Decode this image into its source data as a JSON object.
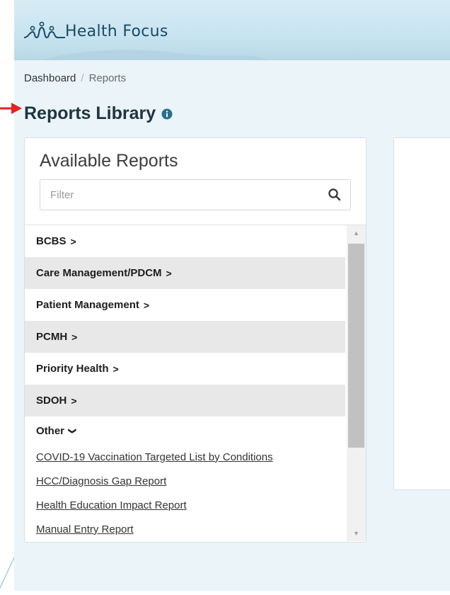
{
  "brand": {
    "name": "Health Focus"
  },
  "breadcrumb": {
    "items": [
      "Dashboard",
      "Reports"
    ],
    "separator": "/"
  },
  "page": {
    "title": "Reports Library"
  },
  "panel": {
    "title": "Available Reports",
    "filter": {
      "placeholder": "Filter",
      "value": ""
    },
    "categories": [
      {
        "label": "BCBS",
        "chevron": ">"
      },
      {
        "label": "Care Management/PDCM",
        "chevron": ">"
      },
      {
        "label": "Patient Management",
        "chevron": ">"
      },
      {
        "label": "PCMH",
        "chevron": ">"
      },
      {
        "label": "Priority Health",
        "chevron": ">"
      },
      {
        "label": "SDOH",
        "chevron": ">"
      },
      {
        "label": "Other",
        "chevron": "❯"
      }
    ],
    "other_reports": [
      "COVID-19 Vaccination Targeted List by Conditions",
      "HCC/Diagnosis Gap Report",
      "Health Education Impact Report",
      "Manual Entry Report"
    ]
  },
  "colors": {
    "accent": "#2a6f8f",
    "title": "#1f3340",
    "row_alt": "#e8e8e8",
    "background": "#eaf4f9",
    "arrow": "#e32222"
  },
  "icons": {
    "logo": "health-focus-logo-icon",
    "info": "info-icon",
    "search": "search-icon",
    "annotation": "red-arrow-icon"
  }
}
